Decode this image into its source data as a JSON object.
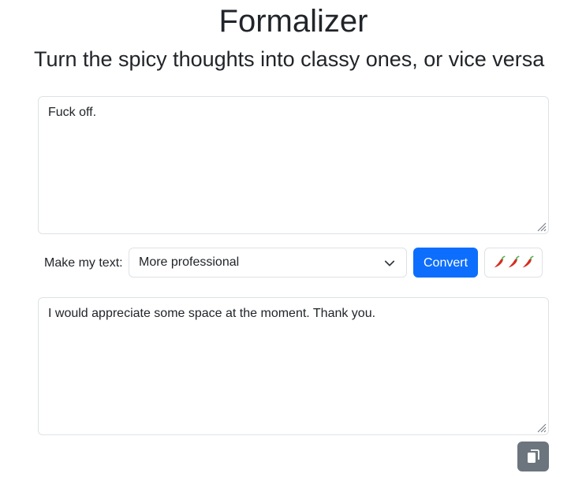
{
  "header": {
    "title": "Formalizer",
    "subtitle": "Turn the spicy thoughts into classy ones, or vice versa"
  },
  "input": {
    "value": "Fuck off."
  },
  "controls": {
    "label": "Make my text:",
    "selected_option": "More professional",
    "convert_label": "Convert",
    "spice_icons": [
      "chili-pepper-icon",
      "chili-pepper-icon",
      "chili-pepper-icon"
    ]
  },
  "output": {
    "value": "I would appreciate some space at the moment. Thank you."
  },
  "copy_button": {
    "icon": "copy-icon"
  },
  "colors": {
    "primary": "#0d6efd",
    "secondary": "#6c757d",
    "border": "#dee2e6",
    "chili_red": "#d62d20",
    "chili_stem": "#4caf50"
  }
}
